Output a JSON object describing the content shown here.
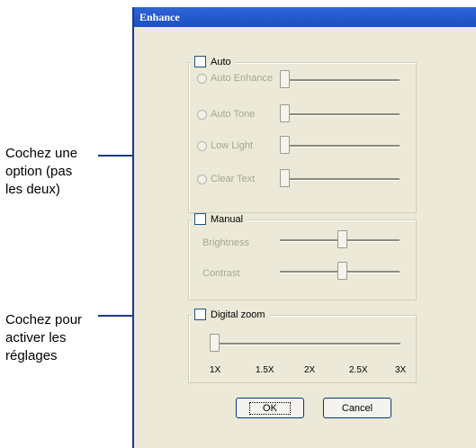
{
  "callouts": {
    "option": [
      "Cochez une",
      "option (pas",
      "les deux)"
    ],
    "settings": [
      "Cochez pour",
      "activer les",
      "réglages"
    ]
  },
  "dialog": {
    "title": "Enhance",
    "auto": {
      "label": "Auto",
      "options": [
        "Auto Enhance",
        "Auto Tone",
        "Low Light",
        "Clear Text"
      ]
    },
    "manual": {
      "label": "Manual",
      "brightness": "Brightness",
      "contrast": "Contrast"
    },
    "zoom": {
      "label": "Digital zoom",
      "ticks": [
        "1X",
        "1.5X",
        "2X",
        "2.5X",
        "3X"
      ]
    },
    "buttons": {
      "ok": "OK",
      "cancel": "Cancel"
    }
  }
}
